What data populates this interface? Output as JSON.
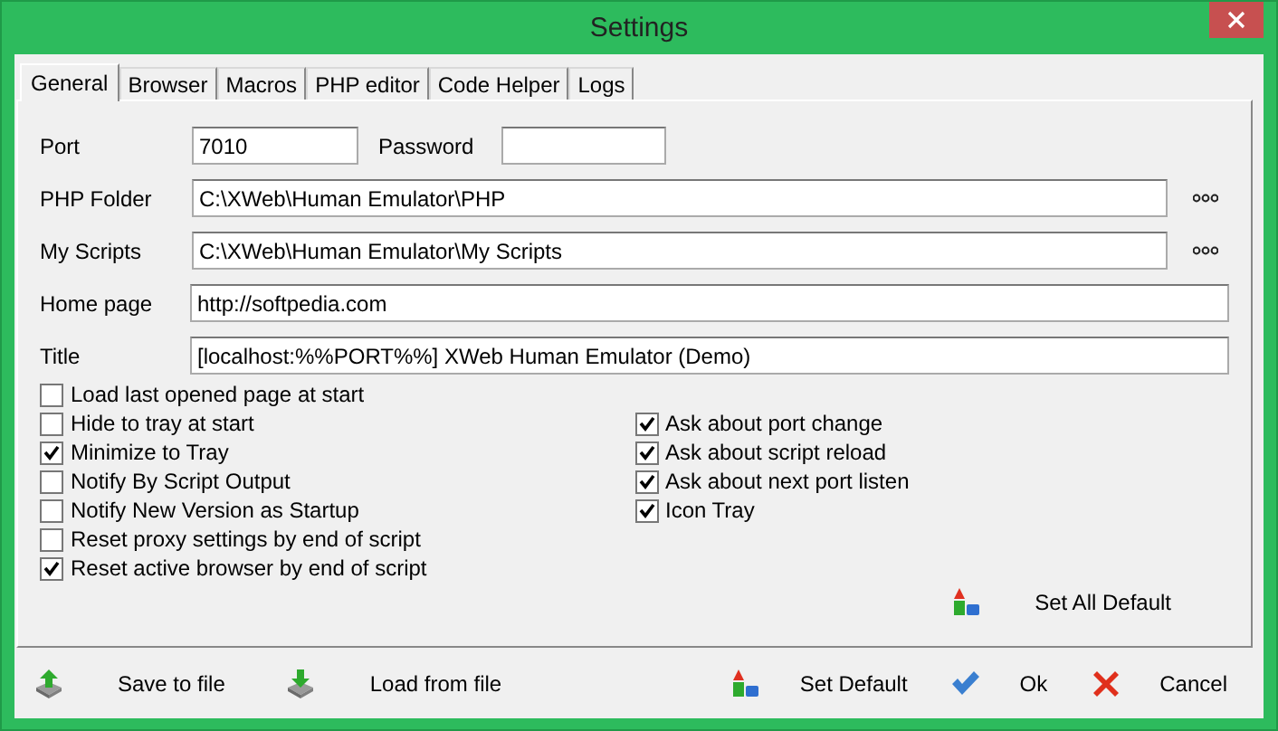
{
  "window": {
    "title": "Settings"
  },
  "tabs": [
    {
      "label": "General",
      "selected": true
    },
    {
      "label": "Browser",
      "selected": false
    },
    {
      "label": "Macros",
      "selected": false
    },
    {
      "label": "PHP editor",
      "selected": false
    },
    {
      "label": "Code Helper",
      "selected": false
    },
    {
      "label": "Logs",
      "selected": false
    }
  ],
  "port": {
    "label": "Port",
    "value": "7010"
  },
  "password": {
    "label": "Password"
  },
  "paths": [
    {
      "label": "PHP Folder",
      "value": "C:\\XWeb\\Human Emulator\\PHP",
      "browse": true
    },
    {
      "label": "My Scripts",
      "value": "C:\\XWeb\\Human Emulator\\My Scripts",
      "browse": true
    },
    {
      "label": "Home page",
      "value": "http://softpedia.com",
      "browse": false
    },
    {
      "label": "Title",
      "value": "[localhost:%%PORT%%] XWeb Human Emulator (Demo)",
      "browse": false
    }
  ],
  "options_left": [
    {
      "label": "Load last opened page at start",
      "checked": false
    },
    {
      "label": "Hide to tray at start",
      "checked": false
    },
    {
      "label": "Minimize to Tray",
      "checked": true
    },
    {
      "label": "Notify By Script Output",
      "checked": false
    },
    {
      "label": "Notify New Version as Startup",
      "checked": false
    },
    {
      "label": "Reset proxy settings by end of script",
      "checked": false
    },
    {
      "label": "Reset active browser by end of script",
      "checked": true
    }
  ],
  "options_right": [
    {
      "label": "Ask about port change",
      "checked": true
    },
    {
      "label": "Ask about script reload",
      "checked": true
    },
    {
      "label": "Ask about next port listen",
      "checked": true
    },
    {
      "label": "Icon Tray",
      "checked": true
    }
  ],
  "set_all_default": {
    "label": "Set All Default"
  },
  "footer_left": [
    {
      "kind": "save",
      "label": "Save to file"
    },
    {
      "kind": "load",
      "label": "Load from file"
    }
  ],
  "footer_right": [
    {
      "kind": "default",
      "label": "Set Default"
    },
    {
      "kind": "ok",
      "label": "Ok"
    },
    {
      "kind": "cancel",
      "label": "Cancel"
    }
  ]
}
